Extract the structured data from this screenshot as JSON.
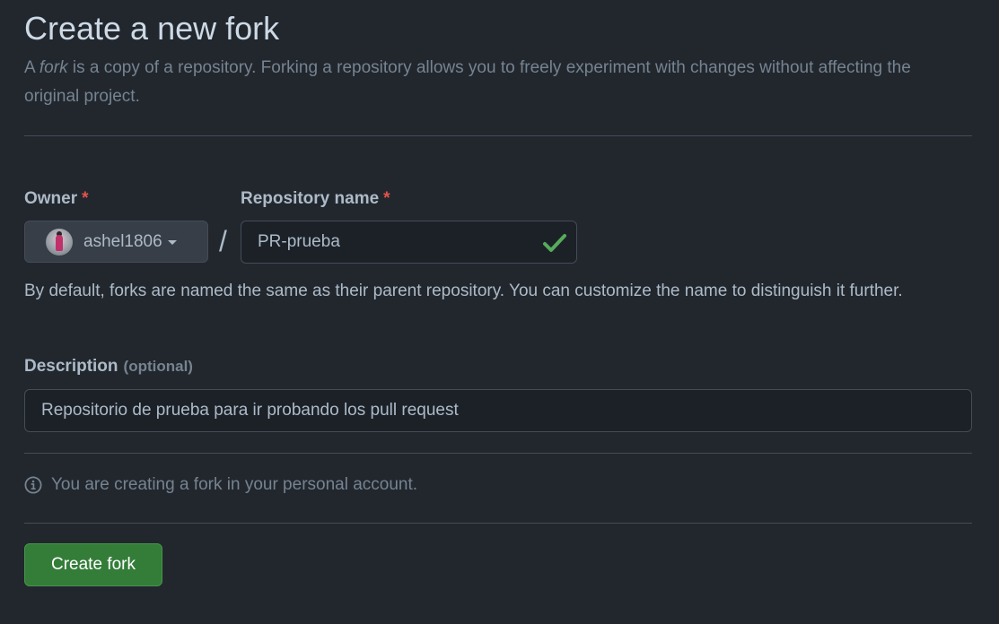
{
  "header": {
    "title": "Create a new fork",
    "subtitle_prefix": "A ",
    "subtitle_em": "fork",
    "subtitle_rest": " is a copy of a repository. Forking a repository allows you to freely experiment with changes without affecting the original project."
  },
  "owner": {
    "label": "Owner",
    "required_marker": "*",
    "username": "ashel1806"
  },
  "separator": "/",
  "repository": {
    "label": "Repository name",
    "required_marker": "*",
    "value": "PR-prueba",
    "valid": true
  },
  "help_text": "By default, forks are named the same as their parent repository. You can customize the name to distinguish it further.",
  "description": {
    "label": "Description",
    "optional_label": "(optional)",
    "value": "Repositorio de prueba para ir probando los pull request"
  },
  "notice": {
    "text": "You are creating a fork in your personal account."
  },
  "actions": {
    "create_label": "Create fork"
  },
  "colors": {
    "background": "#22272e",
    "accent_green": "#347d39",
    "required_red": "#e5534b",
    "valid_check": "#57ab5a"
  },
  "icons": {
    "owner_dropdown": "triangle-down-icon",
    "valid": "check-icon",
    "notice": "info-icon"
  }
}
